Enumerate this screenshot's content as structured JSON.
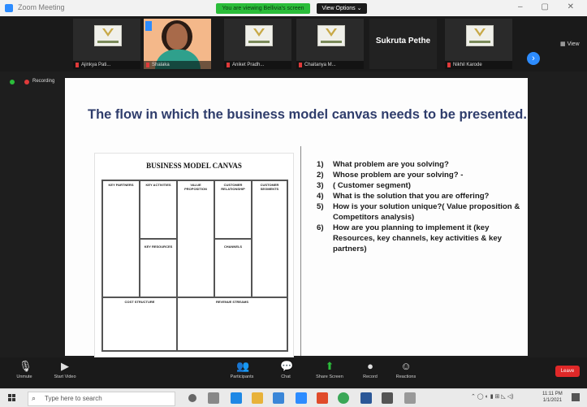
{
  "window": {
    "title": "Zoom Meeting",
    "share_banner": "You are viewing Bellivia's screen",
    "view_options": "View Options ⌄"
  },
  "participants": [
    {
      "name": "Ajinkya Pati..."
    },
    {
      "name": "Shalaka"
    },
    {
      "name": "Aniket Pradh..."
    },
    {
      "name": "Chaitanya M..."
    },
    {
      "name": "Sukruta Pethe"
    },
    {
      "name": "Nikhil Karode"
    }
  ],
  "view_label": "View",
  "recording_label": "Recording",
  "slide": {
    "title": "The flow in which the business model canvas needs to be presented.",
    "canvas_title": "BUSINESS MODEL CANVAS",
    "cells": {
      "key_partners": "KEY PARTNERS",
      "key_activities": "KEY ACTIVITIES",
      "value_proposition": "VALUE PROPOSITION",
      "customer_relationship": "CUSTOMER RELATIONSHIP",
      "customer_segments": "CUSTOMER SEGMENTS",
      "key_resources": "KEY RESOURCES",
      "channels": "CHANNELS",
      "cost_structure": "COST STRUCTURE",
      "revenue_streams": "REVENUE STREAMS"
    },
    "questions": [
      {
        "num": "1)",
        "text": "What problem are you solving?"
      },
      {
        "num": "2)",
        "text": "Whose problem are your solving? -"
      },
      {
        "num": "3)",
        "text": "( Customer segment)"
      },
      {
        "num": "4)",
        "text": "What is the solution that you are offering?"
      },
      {
        "num": "5)",
        "text": "How is your solution unique?( Value proposition & Competitors analysis)"
      },
      {
        "num": "6)",
        "text": "How are you planning to implement it (key Resources, key channels, key activities & key partners)"
      }
    ]
  },
  "toolbar": {
    "unmute": "Unmute",
    "start_video": "Start Video",
    "participants": "Participants",
    "participants_count": "15",
    "chat": "Chat",
    "share_screen": "Share Screen",
    "record": "Record",
    "reactions": "Reactions",
    "leave": "Leave"
  },
  "taskbar": {
    "search_placeholder": "Type here to search",
    "clock_time": "11:11 PM",
    "clock_date": "1/1/2021"
  },
  "colors": {
    "zoom_blue": "#2d8cff",
    "share_green": "#2bbd3a",
    "leave_red": "#e02828",
    "slide_title": "#2f3d6c"
  }
}
